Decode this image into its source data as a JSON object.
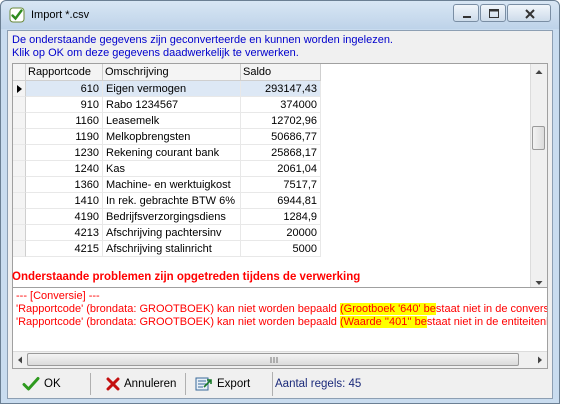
{
  "window": {
    "title": "Import *.csv"
  },
  "info": {
    "line1": "De onderstaande gegevens zijn geconverteerde en kunnen worden ingelezen.",
    "line2": "Klik op OK om deze gegevens daadwerkelijk te verwerken."
  },
  "grid": {
    "columns": [
      "Rapportcode",
      "Omschrijving",
      "Saldo"
    ],
    "rows": [
      {
        "code": "610",
        "oms": "Eigen vermogen",
        "saldo": "293147,43"
      },
      {
        "code": "910",
        "oms": "Rabo 1234567",
        "saldo": "374000"
      },
      {
        "code": "1160",
        "oms": "Leasemelk",
        "saldo": "12702,96"
      },
      {
        "code": "1190",
        "oms": "Melkopbrengsten",
        "saldo": "50686,77"
      },
      {
        "code": "1230",
        "oms": "Rekening courant bank",
        "saldo": "25868,17"
      },
      {
        "code": "1240",
        "oms": "Kas",
        "saldo": "2061,04"
      },
      {
        "code": "1360",
        "oms": "Machine- en werktuigkost",
        "saldo": "7517,7"
      },
      {
        "code": "1410",
        "oms": "In rek. gebrachte BTW 6%",
        "saldo": "6944,81"
      },
      {
        "code": "4190",
        "oms": "Bedrijfsverzorgingsdiens",
        "saldo": "1284,9"
      },
      {
        "code": "4213",
        "oms": "Afschrijving pachtersinv",
        "saldo": "20000"
      },
      {
        "code": "4215",
        "oms": "Afschrijving stalinricht",
        "saldo": "5000"
      }
    ]
  },
  "problems": {
    "title": "Onderstaande problemen zijn opgetreden tijdens de verwerking",
    "header": "--- [Conversie] ---",
    "lines": [
      {
        "pre": "'Rapportcode' (brondata: GROOTBOEK) kan niet worden bepaald ",
        "hl": "(Grootboek '640' be",
        "post": "staat niet in de conversi"
      },
      {
        "pre": "'Rapportcode' (brondata: GROOTBOEK) kan niet worden bepaald ",
        "hl": "(Waarde ''401'' be",
        "post": "staat niet in de entiteitenl"
      }
    ]
  },
  "toolbar": {
    "ok": "OK",
    "annuleren": "Annuleren",
    "export": "Export",
    "count": "Aantal regels: 45"
  }
}
